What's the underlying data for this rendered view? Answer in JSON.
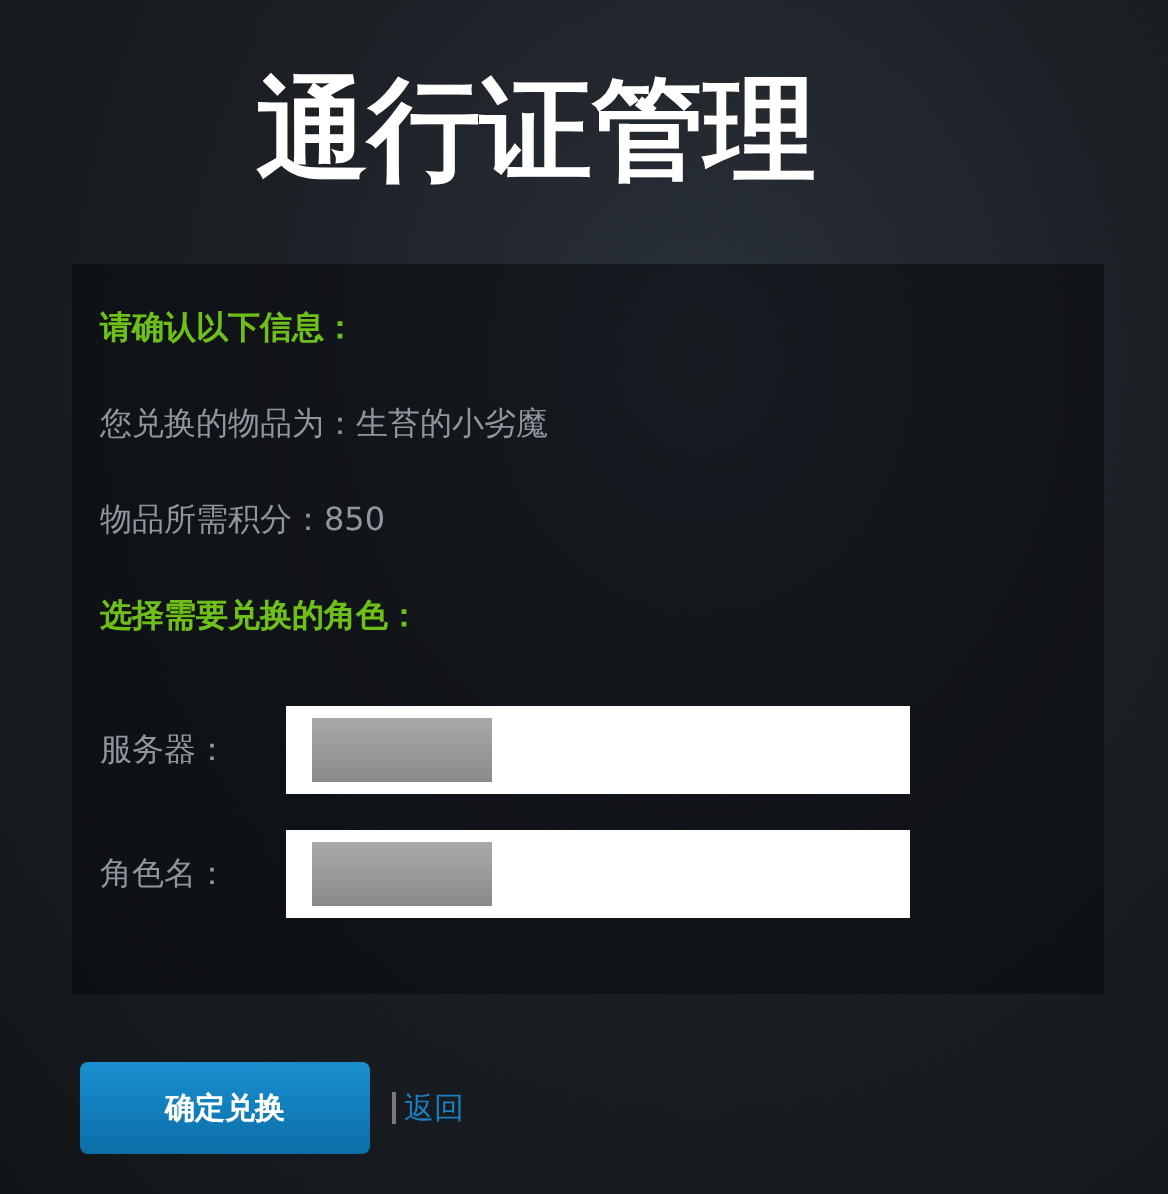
{
  "title": "通行证管理",
  "panel": {
    "heading": "请确认以下信息：",
    "info": [
      "您兑换的物品为：生苔的小劣魔",
      "物品所需积分：850"
    ],
    "subheading": "选择需要兑换的角色：",
    "fields": [
      {
        "label": "服务器："
      },
      {
        "label": "角色名："
      }
    ]
  },
  "actions": {
    "confirm": "确定兑换",
    "back": "返回"
  }
}
